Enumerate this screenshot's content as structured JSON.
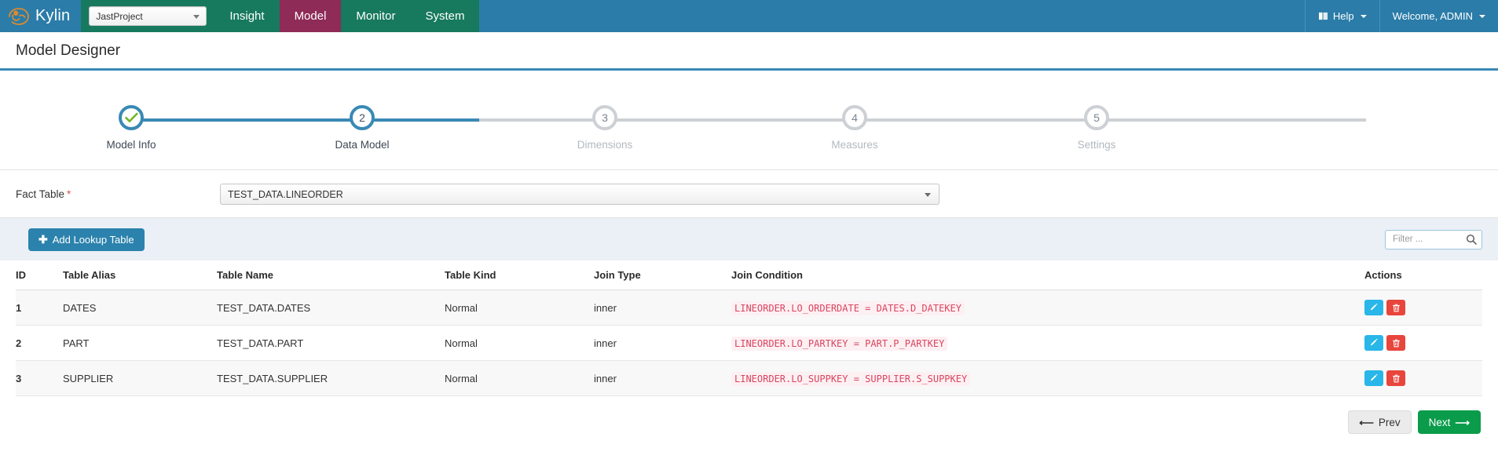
{
  "navbar": {
    "brand": "Kylin",
    "brand_logo_icon": "kylin-logo-icon",
    "project_selected": "JastProject",
    "items": [
      {
        "label": "Insight",
        "active": false
      },
      {
        "label": "Model",
        "active": true
      },
      {
        "label": "Monitor",
        "active": false
      },
      {
        "label": "System",
        "active": false
      }
    ],
    "help_label": "Help",
    "help_icon": "book-icon",
    "user_label": "Welcome, ADMIN",
    "colors": {
      "bar": "#2b7ca8",
      "nav": "#17795e",
      "active": "#8e2b57",
      "underline": "#3a89b5"
    }
  },
  "page": {
    "title": "Model Designer"
  },
  "wizard": {
    "steps": [
      {
        "number": "1",
        "label": "Model Info",
        "state": "done",
        "icon": "check-icon"
      },
      {
        "number": "2",
        "label": "Data Model",
        "state": "current",
        "icon": ""
      },
      {
        "number": "3",
        "label": "Dimensions",
        "state": "todo",
        "icon": ""
      },
      {
        "number": "4",
        "label": "Measures",
        "state": "todo",
        "icon": ""
      },
      {
        "number": "5",
        "label": "Settings",
        "state": "todo",
        "icon": ""
      }
    ]
  },
  "fact_table": {
    "label": "Fact Table",
    "required_mark": "*",
    "selected": "TEST_DATA.LINEORDER",
    "caret_icon": "chevron-down-icon"
  },
  "toolbar": {
    "add_lookup_label": "Add Lookup Table",
    "add_lookup_icon": "plus-icon",
    "filter_placeholder": "Filter ...",
    "filter_value": "",
    "search_icon": "search-icon"
  },
  "table": {
    "headers": {
      "id": "ID",
      "alias": "Table Alias",
      "name": "Table Name",
      "kind": "Table Kind",
      "join": "Join Type",
      "condition": "Join Condition",
      "actions": "Actions"
    },
    "rows": [
      {
        "id": "1",
        "alias": "DATES",
        "name": "TEST_DATA.DATES",
        "kind": "Normal",
        "join": "inner",
        "condition": "LINEORDER.LO_ORDERDATE = DATES.D_DATEKEY"
      },
      {
        "id": "2",
        "alias": "PART",
        "name": "TEST_DATA.PART",
        "kind": "Normal",
        "join": "inner",
        "condition": "LINEORDER.LO_PARTKEY = PART.P_PARTKEY"
      },
      {
        "id": "3",
        "alias": "SUPPLIER",
        "name": "TEST_DATA.SUPPLIER",
        "kind": "Normal",
        "join": "inner",
        "condition": "LINEORDER.LO_SUPPKEY = SUPPLIER.S_SUPPKEY"
      }
    ],
    "row_action_icons": {
      "edit": "pencil-icon",
      "delete": "trash-icon"
    }
  },
  "footer": {
    "prev_label": "Prev",
    "next_label": "Next",
    "prev_icon": "arrow-left-icon",
    "next_icon": "arrow-right-icon"
  }
}
